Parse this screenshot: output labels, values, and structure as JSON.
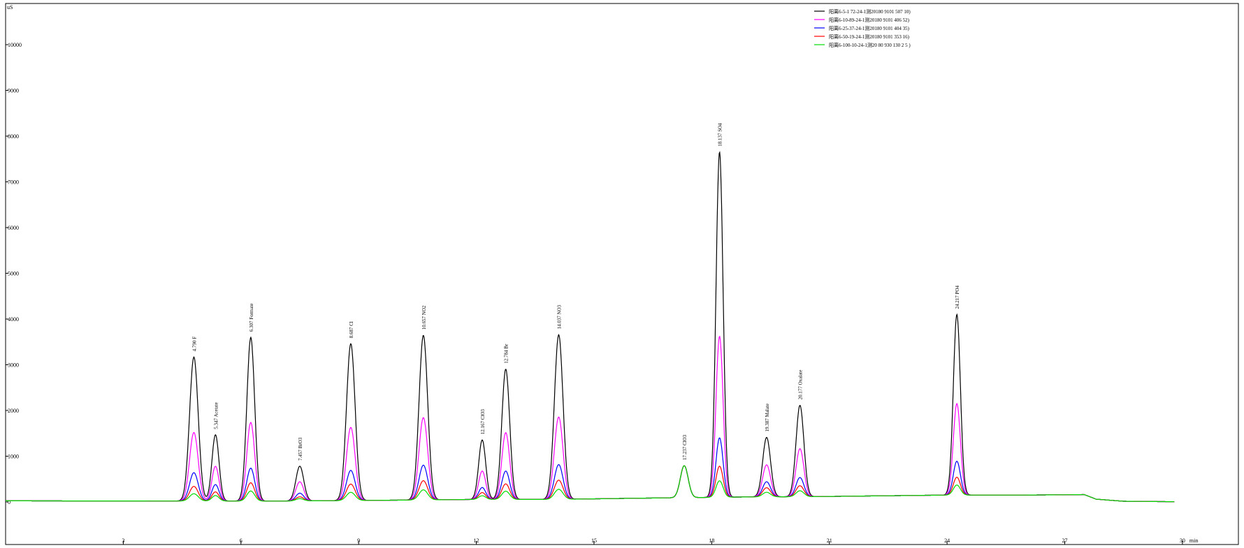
{
  "chart_data": {
    "type": "line",
    "title": "",
    "ylabel": "uS",
    "xlabel": "min",
    "xlim": [
      0,
      31.5
    ],
    "ylim": [
      -1000,
      11000
    ],
    "y_ticks": [
      {
        "value": 10000,
        "label": "10000"
      },
      {
        "value": 9000,
        "label": "9000"
      },
      {
        "value": 8000,
        "label": "8000"
      },
      {
        "value": 7000,
        "label": "7000"
      },
      {
        "value": 6000,
        "label": "6000"
      },
      {
        "value": 5000,
        "label": "5000"
      },
      {
        "value": 4000,
        "label": "4000"
      },
      {
        "value": 3000,
        "label": "3000"
      },
      {
        "value": 2000,
        "label": "2000"
      },
      {
        "value": 1000,
        "label": "1000"
      },
      {
        "value": 0,
        "label": "0"
      }
    ],
    "x_ticks": [
      {
        "value": 3,
        "label": "3"
      },
      {
        "value": 6,
        "label": "6"
      },
      {
        "value": 9,
        "label": "9"
      },
      {
        "value": 12,
        "label": "12"
      },
      {
        "value": 15,
        "label": "15"
      },
      {
        "value": 18,
        "label": "18"
      },
      {
        "value": 21,
        "label": "21"
      },
      {
        "value": 24,
        "label": "24"
      },
      {
        "value": 27,
        "label": "27"
      },
      {
        "value": 30,
        "label": "30"
      }
    ],
    "legend_position": "top-right",
    "series": [
      {
        "name": "阳离6-5-1 72-24-1测20180 9101 507 10)",
        "color": "#000000",
        "heights": [
          3150,
          1450,
          3580,
          760,
          3430,
          3600,
          1300,
          2850,
          3600,
          700,
          7550,
          1300,
          2000,
          3950
        ]
      },
      {
        "name": "阳离6-10-89-24-1测20180 9101 406 52)",
        "color": "#ff00ff",
        "heights": [
          1500,
          760,
          1720,
          420,
          1600,
          1800,
          620,
          1460,
          1800,
          700,
          3520,
          700,
          1050,
          2000
        ]
      },
      {
        "name": "阳离6-25-37-24-1测20180 9101 404 35)",
        "color": "#0000ff",
        "heights": [
          620,
          360,
          720,
          170,
          660,
          760,
          260,
          620,
          760,
          700,
          1300,
          330,
          420,
          740
        ]
      },
      {
        "name": "阳离6-50-19-24-1测20180 9101 353 16)",
        "color": "#ff0000",
        "heights": [
          320,
          200,
          400,
          90,
          360,
          420,
          150,
          340,
          420,
          700,
          680,
          200,
          240,
          390
        ]
      },
      {
        "name": "阳离6-100-10-24-1测20 80 930 130 2 5 )",
        "color": "#00dd00",
        "heights": [
          160,
          120,
          220,
          50,
          180,
          220,
          80,
          180,
          220,
          700,
          360,
          100,
          130,
          220
        ]
      }
    ],
    "peaks": [
      {
        "rt": 4.8,
        "label": "4.790  F",
        "x": 4.8
      },
      {
        "rt": 5.35,
        "label": "5.347  Acetate",
        "x": 5.35
      },
      {
        "rt": 6.25,
        "label": "6.307  Formate",
        "x": 6.25
      },
      {
        "rt": 7.5,
        "label": "7.457  BrO3",
        "x": 7.5
      },
      {
        "rt": 8.8,
        "label": "8.687  Cl",
        "x": 8.8
      },
      {
        "rt": 10.65,
        "label": "10.657  NO2",
        "x": 10.65
      },
      {
        "rt": 12.15,
        "label": "12.167  ClO3",
        "x": 12.15
      },
      {
        "rt": 12.75,
        "label": "12.784  Br",
        "x": 12.75
      },
      {
        "rt": 14.1,
        "label": "14.037  NO3",
        "x": 14.1
      },
      {
        "rt": 17.3,
        "label": "17.237  ClO3",
        "x": 17.3
      },
      {
        "rt": 18.2,
        "label": "18.137  SO4",
        "x": 18.2
      },
      {
        "rt": 19.4,
        "label": "19.387  Malate",
        "x": 19.4
      },
      {
        "rt": 20.25,
        "label": "20.177  Oxalate",
        "x": 20.25
      },
      {
        "rt": 24.25,
        "label": "24.217  PO4",
        "x": 24.25
      }
    ],
    "peak_widths": [
      0.11,
      0.09,
      0.1,
      0.1,
      0.11,
      0.11,
      0.09,
      0.1,
      0.11,
      0.1,
      0.09,
      0.1,
      0.1,
      0.09
    ],
    "grid": false
  }
}
